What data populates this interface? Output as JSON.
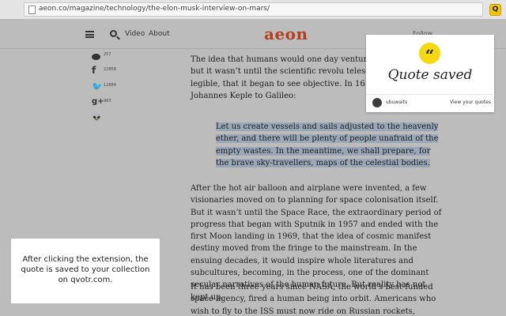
{
  "browser": {
    "url": "aeon.co/magazine/technology/the-elon-musk-interview-on-mars/",
    "extension_label": "Q"
  },
  "site": {
    "logo": "aeon",
    "nav": [
      "Video",
      "About"
    ],
    "follow_label": "Follow"
  },
  "share": {
    "comments_count": "257",
    "facebook_count": "22858",
    "twitter_count": "12884",
    "googleplus_count": "983"
  },
  "article": {
    "paragraph_1": "The idea that humans would one day venture into mythology, but it wasn’t until the scientific revolu telescope made the sky legible, that it began to see objective. In 1610, the astronomer Johannes Keple to Galileo:",
    "quote": "Let us create vessels and sails adjusted to the heavenly ether, and there will be plenty of people unafraid of the empty wastes. In the meantime, we shall prepare, for the brave sky-travellers, maps of the celestial bodies.",
    "paragraph_2": "After the hot air balloon and airplane were invented, a few visionaries moved on to planning for space colonisation itself. But it wasn’t until the Space Race, the extraordinary period of progress that began with Sputnik in 1957 and ended with the first Moon landing in 1969, that the idea of cosmic manifest destiny moved from the fringe to the mainstream. In the ensuing decades, it would inspire whole literatures and subcultures, becoming, in the process, one of the dominant secular narratives of the human future. But reality has not kept up.",
    "paragraph_3": "It has been three years since NASA, the world’s best-funded space agency, fired a human being into orbit. Americans who wish to fly to the ISS must now ride on Russian rockets, launched from Kazakhstan"
  },
  "popup": {
    "quote_mark": "“",
    "title": "Quote saved",
    "username": "ubuwaits",
    "view_link": "View your quotes"
  },
  "callout": {
    "text": "After clicking the extension, the quote is saved to your collection on qvotr.com."
  },
  "colors": {
    "accent_yellow": "#f5d90e",
    "logo_red": "#b5401e",
    "highlight": "#9aa7b9"
  }
}
